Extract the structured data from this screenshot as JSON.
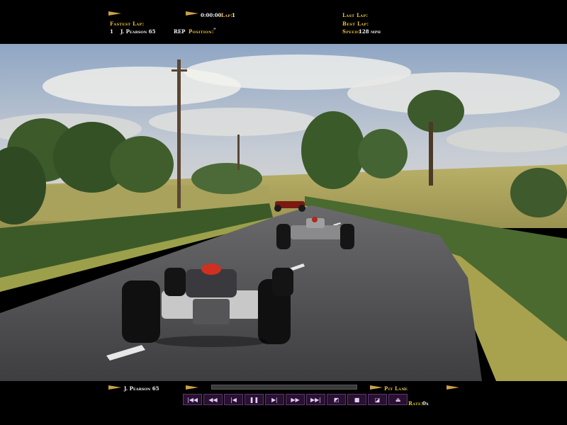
{
  "hud_top": {
    "lap_time": "0:00:00",
    "lap_label": "Lap:",
    "lap_value": "1",
    "fastest_lap_label": "Fastest Lap:",
    "fastest_lap_position": "1",
    "fastest_lap_driver": "J. Pearson 65",
    "rep_label": "REP",
    "position_label": "Position:",
    "position_value": "\"",
    "last_lap_label": "Last Lap:",
    "best_lap_label": "Best Lap:",
    "speed_label": "Speed:",
    "speed_value": "128 mph"
  },
  "hud_bottom": {
    "driver": "J. Pearson 65",
    "pit_lane_label": "Pit Lane",
    "pit_lane_value": ":",
    "rate_label": "Rate:",
    "rate_value": "0x",
    "replay_progress": 0.0,
    "buttons": [
      {
        "name": "skip-start-button",
        "glyph": "|◀◀"
      },
      {
        "name": "fast-rewind-button",
        "glyph": "◀◀"
      },
      {
        "name": "step-back-button",
        "glyph": "|◀"
      },
      {
        "name": "pause-button",
        "glyph": "❚❚"
      },
      {
        "name": "step-forward-button",
        "glyph": "▶|"
      },
      {
        "name": "play-button",
        "glyph": "▶▶"
      },
      {
        "name": "fast-forward-button",
        "glyph": "▶▶|"
      },
      {
        "name": "camera-button",
        "glyph": "◩"
      },
      {
        "name": "stop-button",
        "glyph": "■"
      },
      {
        "name": "record-button",
        "glyph": "◪"
      },
      {
        "name": "eject-button",
        "glyph": "⏏"
      }
    ]
  },
  "colors": {
    "hud_label": "#e8c23a",
    "hud_value": "#f0f0f0",
    "button_bg": "#2a1033"
  }
}
